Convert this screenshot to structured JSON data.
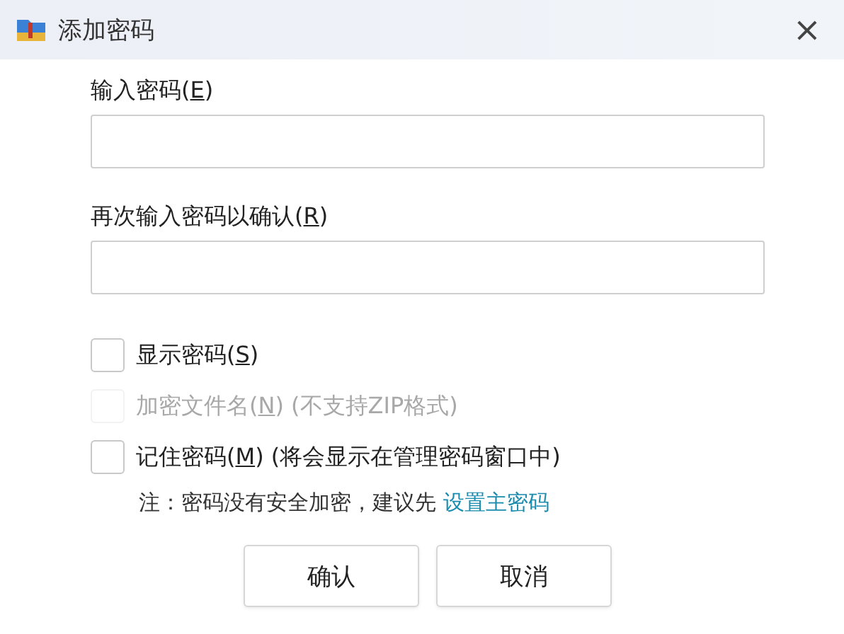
{
  "window": {
    "title": "添加密码",
    "close": "×"
  },
  "fields": [
    {
      "label": {
        "before": "输入密码(",
        "key": "E",
        "after": ")"
      }
    },
    {
      "label": {
        "before": "再次输入密码以确认(",
        "key": "R",
        "after": ")"
      }
    }
  ],
  "options": [
    {
      "label": {
        "before": "显示密码(",
        "key": "S",
        "after": ")"
      },
      "checked": false,
      "disabled": false
    },
    {
      "label": {
        "before": "加密文件名(",
        "key": "N",
        "after": ")"
      },
      "extra": "(不支持ZIP格式)",
      "checked": false,
      "disabled": true
    },
    {
      "label": {
        "before": "记住密码(",
        "key": "M",
        "after": ")"
      },
      "extra": "(将会显示在管理密码窗口中)",
      "checked": false,
      "disabled": false
    }
  ],
  "note": {
    "text": "注：密码没有安全加密，建议先",
    "link": "设置主密码"
  },
  "buttons": [
    "确认",
    "取消"
  ]
}
